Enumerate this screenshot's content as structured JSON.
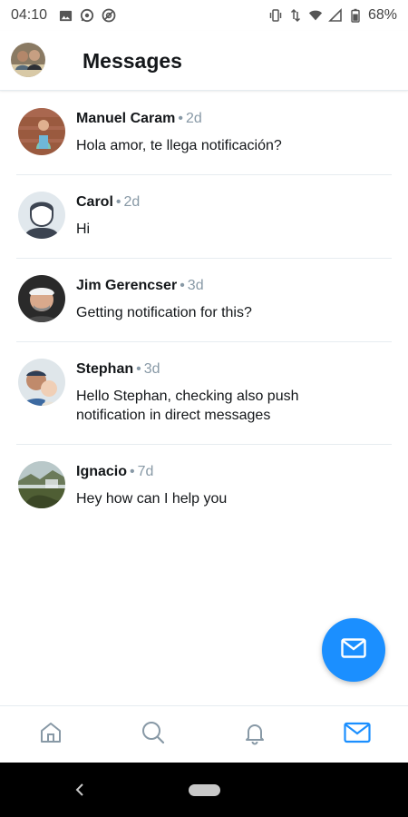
{
  "status_bar": {
    "time": "04:10",
    "left_icons": [
      "image-icon",
      "whatsapp-icon",
      "at-sign-icon"
    ],
    "right_icons": [
      "vibrate-icon",
      "data-arrows-icon",
      "wifi-icon",
      "signal-icon",
      "battery-icon"
    ],
    "battery": "68%"
  },
  "header": {
    "title": "Messages"
  },
  "conversations": [
    {
      "name": "Manuel Caram",
      "time": "2d",
      "preview": "Hola amor, te llega notificación?"
    },
    {
      "name": "Carol",
      "time": "2d",
      "preview": "Hi"
    },
    {
      "name": "Jim Gerencser",
      "time": "3d",
      "preview": "Getting notification for this?"
    },
    {
      "name": "Stephan",
      "time": "3d",
      "preview": "Hello Stephan, checking also push notification in direct messages"
    },
    {
      "name": "Ignacio",
      "time": "7d",
      "preview": "Hey how can I help you"
    }
  ],
  "separator": "•",
  "fab": {
    "icon": "mail-icon"
  },
  "bottom_nav": [
    "home-icon",
    "search-icon",
    "bell-icon",
    "mail-icon"
  ],
  "colors": {
    "accent": "#1b8fff",
    "muted": "#8899a6",
    "text": "#14171a",
    "divider": "#e6ecf0"
  }
}
